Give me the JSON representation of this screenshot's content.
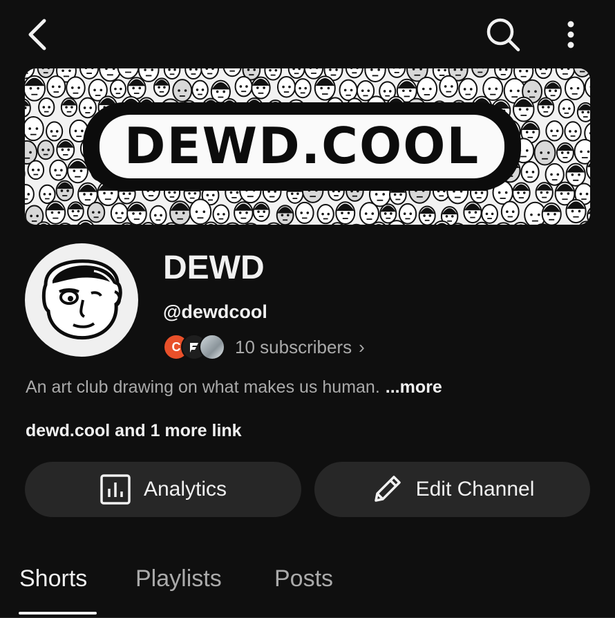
{
  "header": {
    "back_icon": "back-arrow-icon",
    "search_icon": "search-icon",
    "more_icon": "more-vertical-icon"
  },
  "banner": {
    "text": "DEWD.COOL"
  },
  "channel": {
    "name": "DEWD",
    "handle": "@dewdcool",
    "subscriber_avatar_initials": [
      "C",
      "F",
      ""
    ],
    "subscribers": "10 subscribers",
    "subscribers_chevron": "›",
    "description": "An art club drawing on what makes us human.",
    "description_more": "...more",
    "links": "dewd.cool and 1 more link"
  },
  "actions": {
    "analytics_label": "Analytics",
    "analytics_icon": "analytics-icon",
    "edit_label": "Edit Channel",
    "edit_icon": "pencil-icon"
  },
  "tabs": [
    {
      "label": "Shorts",
      "active": true
    },
    {
      "label": "Playlists",
      "active": false
    },
    {
      "label": "Posts",
      "active": false
    }
  ],
  "colors": {
    "background": "#0f0f0f",
    "button_bg": "#272727",
    "text_primary": "#f1f1f1",
    "text_secondary": "#aaaaaa",
    "sub_avatar_c": "#e8502a"
  }
}
